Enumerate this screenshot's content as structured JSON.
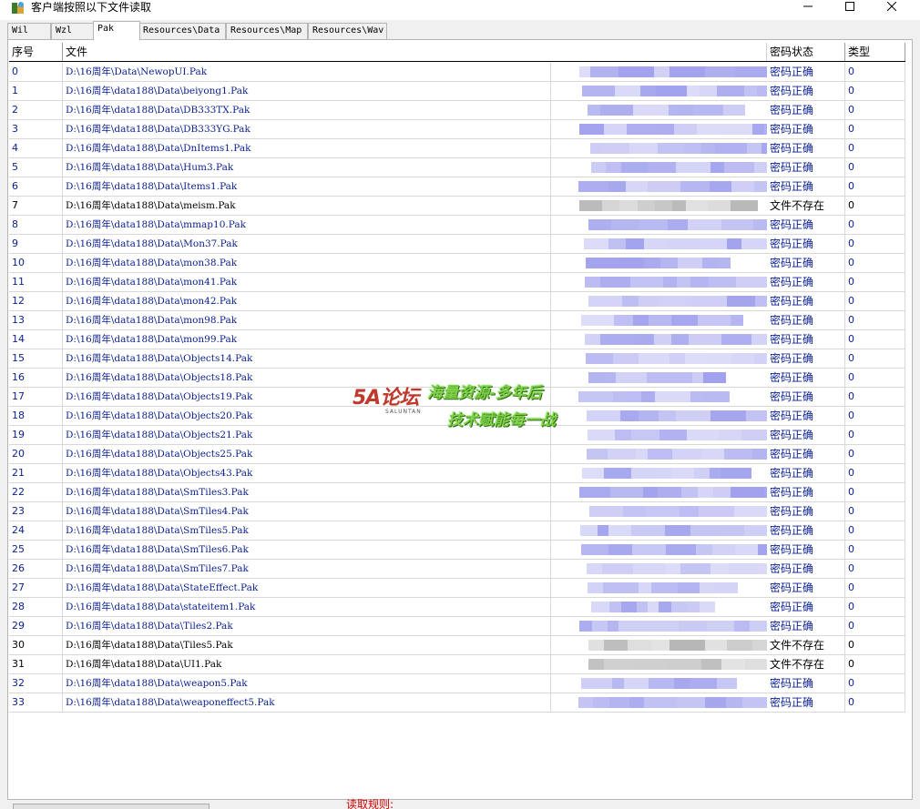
{
  "window": {
    "title": "客户端按照以下文件读取",
    "minimize_icon": "minimize-icon",
    "maximize_icon": "maximize-icon",
    "close_icon": "close-icon"
  },
  "tabs": [
    {
      "label": "Wil",
      "active": false
    },
    {
      "label": "Wzl",
      "active": false
    },
    {
      "label": "Pak",
      "active": true
    },
    {
      "label": "Resources\\Data",
      "active": false
    },
    {
      "label": "Resources\\Map",
      "active": false
    },
    {
      "label": "Resources\\Wav",
      "active": false
    }
  ],
  "list": {
    "columns": {
      "index": "序号",
      "file": "文件",
      "status": "密码状态",
      "type": "类型"
    },
    "rows": [
      {
        "index": "0",
        "file": "D:\\16周年\\Data\\NewopUI.Pak",
        "status": "密码正确",
        "type": "0"
      },
      {
        "index": "1",
        "file": "D:\\16周年\\data188\\Data\\beiyong1.Pak",
        "status": "密码正确",
        "type": "0"
      },
      {
        "index": "2",
        "file": "D:\\16周年\\data188\\Data\\DB333TX.Pak",
        "status": "密码正确",
        "type": "0"
      },
      {
        "index": "3",
        "file": "D:\\16周年\\data188\\Data\\DB333YG.Pak",
        "status": "密码正确",
        "type": "0"
      },
      {
        "index": "4",
        "file": "D:\\16周年\\data188\\Data\\DnItems1.Pak",
        "status": "密码正确",
        "type": "0"
      },
      {
        "index": "5",
        "file": "D:\\16周年\\data188\\Data\\Hum3.Pak",
        "status": "密码正确",
        "type": "0"
      },
      {
        "index": "6",
        "file": "D:\\16周年\\data188\\Data\\Items1.Pak",
        "status": "密码正确",
        "type": "0"
      },
      {
        "index": "7",
        "file": "D:\\16周年\\data188\\Data\\meism.Pak",
        "status": "文件不存在",
        "type": "0"
      },
      {
        "index": "8",
        "file": "D:\\16周年\\data188\\Data\\mmap10.Pak",
        "status": "密码正确",
        "type": "0"
      },
      {
        "index": "9",
        "file": "D:\\16周年\\data188\\Data\\Mon37.Pak",
        "status": "密码正确",
        "type": "0"
      },
      {
        "index": "10",
        "file": "D:\\16周年\\data188\\Data\\mon38.Pak",
        "status": "密码正确",
        "type": "0"
      },
      {
        "index": "11",
        "file": "D:\\16周年\\data188\\Data\\mon41.Pak",
        "status": "密码正确",
        "type": "0"
      },
      {
        "index": "12",
        "file": "D:\\16周年\\data188\\Data\\mon42.Pak",
        "status": "密码正确",
        "type": "0"
      },
      {
        "index": "13",
        "file": "D:\\16周年\\data188\\Data\\mon98.Pak",
        "status": "密码正确",
        "type": "0"
      },
      {
        "index": "14",
        "file": "D:\\16周年\\data188\\Data\\mon99.Pak",
        "status": "密码正确",
        "type": "0"
      },
      {
        "index": "15",
        "file": "D:\\16周年\\data188\\Data\\Objects14.Pak",
        "status": "密码正确",
        "type": "0"
      },
      {
        "index": "16",
        "file": "D:\\16周年\\data188\\Data\\Objects18.Pak",
        "status": "密码正确",
        "type": "0"
      },
      {
        "index": "17",
        "file": "D:\\16周年\\data188\\Data\\Objects19.Pak",
        "status": "密码正确",
        "type": "0"
      },
      {
        "index": "18",
        "file": "D:\\16周年\\data188\\Data\\Objects20.Pak",
        "status": "密码正确",
        "type": "0"
      },
      {
        "index": "19",
        "file": "D:\\16周年\\data188\\Data\\Objects21.Pak",
        "status": "密码正确",
        "type": "0"
      },
      {
        "index": "20",
        "file": "D:\\16周年\\data188\\Data\\Objects25.Pak",
        "status": "密码正确",
        "type": "0"
      },
      {
        "index": "21",
        "file": "D:\\16周年\\data188\\Data\\Objects43.Pak",
        "status": "密码正确",
        "type": "0"
      },
      {
        "index": "22",
        "file": "D:\\16周年\\data188\\Data\\SmTiles3.Pak",
        "status": "密码正确",
        "type": "0"
      },
      {
        "index": "23",
        "file": "D:\\16周年\\data188\\Data\\SmTiles4.Pak",
        "status": "密码正确",
        "type": "0"
      },
      {
        "index": "24",
        "file": "D:\\16周年\\data188\\Data\\SmTiles5.Pak",
        "status": "密码正确",
        "type": "0"
      },
      {
        "index": "25",
        "file": "D:\\16周年\\data188\\Data\\SmTiles6.Pak",
        "status": "密码正确",
        "type": "0"
      },
      {
        "index": "26",
        "file": "D:\\16周年\\data188\\Data\\SmTiles7.Pak",
        "status": "密码正确",
        "type": "0"
      },
      {
        "index": "27",
        "file": "D:\\16周年\\data188\\Data\\StateEffect.Pak",
        "status": "密码正确",
        "type": "0"
      },
      {
        "index": "28",
        "file": "D:\\16周年\\data188\\Data\\stateitem1.Pak",
        "status": "密码正确",
        "type": "0"
      },
      {
        "index": "29",
        "file": "D:\\16周年\\data188\\Data\\Tiles2.Pak",
        "status": "密码正确",
        "type": "0"
      },
      {
        "index": "30",
        "file": "D:\\16周年\\data188\\Data\\Tiles5.Pak",
        "status": "文件不存在",
        "type": "0"
      },
      {
        "index": "31",
        "file": "D:\\16周年\\data188\\Data\\UI1.Pak",
        "status": "文件不存在",
        "type": "0"
      },
      {
        "index": "32",
        "file": "D:\\16周年\\data188\\Data\\weapon5.Pak",
        "status": "密码正确",
        "type": "0"
      },
      {
        "index": "33",
        "file": "D:\\16周年\\data188\\Data\\weaponeffect5.Pak",
        "status": "密码正确",
        "type": "0"
      }
    ]
  },
  "watermark": {
    "logo": "5A论坛",
    "logo_sub": "SALUNTAN",
    "line1": "海量资源-多年后",
    "line2": "技术赋能每一战"
  },
  "footer": {
    "label": "读取规则:"
  },
  "colors": {
    "ok_text": "#0a1f8f",
    "missing_text": "#000000",
    "accent_red": "#d00000"
  }
}
